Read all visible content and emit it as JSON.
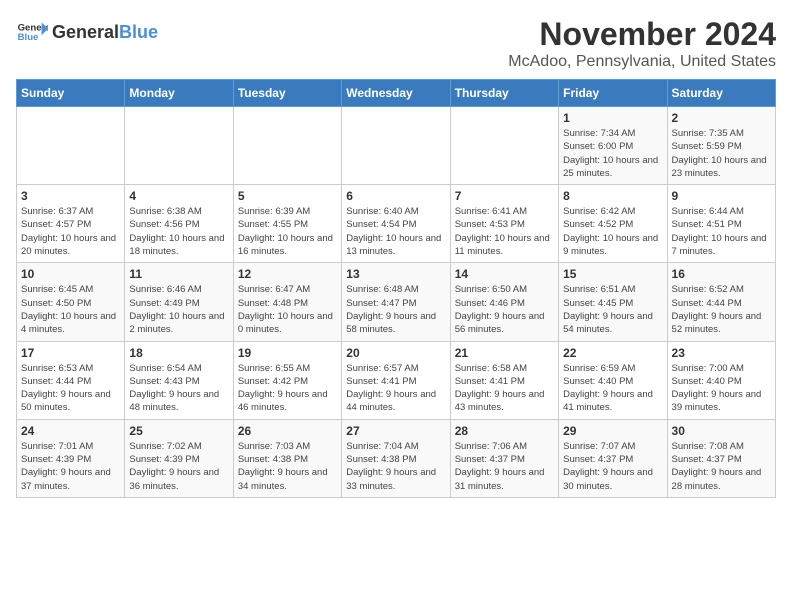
{
  "logo": {
    "general": "General",
    "blue": "Blue"
  },
  "title": "November 2024",
  "subtitle": "McAdoo, Pennsylvania, United States",
  "days_of_week": [
    "Sunday",
    "Monday",
    "Tuesday",
    "Wednesday",
    "Thursday",
    "Friday",
    "Saturday"
  ],
  "weeks": [
    [
      {
        "day": "",
        "info": ""
      },
      {
        "day": "",
        "info": ""
      },
      {
        "day": "",
        "info": ""
      },
      {
        "day": "",
        "info": ""
      },
      {
        "day": "",
        "info": ""
      },
      {
        "day": "1",
        "info": "Sunrise: 7:34 AM\nSunset: 6:00 PM\nDaylight: 10 hours and 25 minutes."
      },
      {
        "day": "2",
        "info": "Sunrise: 7:35 AM\nSunset: 5:59 PM\nDaylight: 10 hours and 23 minutes."
      }
    ],
    [
      {
        "day": "3",
        "info": "Sunrise: 6:37 AM\nSunset: 4:57 PM\nDaylight: 10 hours and 20 minutes."
      },
      {
        "day": "4",
        "info": "Sunrise: 6:38 AM\nSunset: 4:56 PM\nDaylight: 10 hours and 18 minutes."
      },
      {
        "day": "5",
        "info": "Sunrise: 6:39 AM\nSunset: 4:55 PM\nDaylight: 10 hours and 16 minutes."
      },
      {
        "day": "6",
        "info": "Sunrise: 6:40 AM\nSunset: 4:54 PM\nDaylight: 10 hours and 13 minutes."
      },
      {
        "day": "7",
        "info": "Sunrise: 6:41 AM\nSunset: 4:53 PM\nDaylight: 10 hours and 11 minutes."
      },
      {
        "day": "8",
        "info": "Sunrise: 6:42 AM\nSunset: 4:52 PM\nDaylight: 10 hours and 9 minutes."
      },
      {
        "day": "9",
        "info": "Sunrise: 6:44 AM\nSunset: 4:51 PM\nDaylight: 10 hours and 7 minutes."
      }
    ],
    [
      {
        "day": "10",
        "info": "Sunrise: 6:45 AM\nSunset: 4:50 PM\nDaylight: 10 hours and 4 minutes."
      },
      {
        "day": "11",
        "info": "Sunrise: 6:46 AM\nSunset: 4:49 PM\nDaylight: 10 hours and 2 minutes."
      },
      {
        "day": "12",
        "info": "Sunrise: 6:47 AM\nSunset: 4:48 PM\nDaylight: 10 hours and 0 minutes."
      },
      {
        "day": "13",
        "info": "Sunrise: 6:48 AM\nSunset: 4:47 PM\nDaylight: 9 hours and 58 minutes."
      },
      {
        "day": "14",
        "info": "Sunrise: 6:50 AM\nSunset: 4:46 PM\nDaylight: 9 hours and 56 minutes."
      },
      {
        "day": "15",
        "info": "Sunrise: 6:51 AM\nSunset: 4:45 PM\nDaylight: 9 hours and 54 minutes."
      },
      {
        "day": "16",
        "info": "Sunrise: 6:52 AM\nSunset: 4:44 PM\nDaylight: 9 hours and 52 minutes."
      }
    ],
    [
      {
        "day": "17",
        "info": "Sunrise: 6:53 AM\nSunset: 4:44 PM\nDaylight: 9 hours and 50 minutes."
      },
      {
        "day": "18",
        "info": "Sunrise: 6:54 AM\nSunset: 4:43 PM\nDaylight: 9 hours and 48 minutes."
      },
      {
        "day": "19",
        "info": "Sunrise: 6:55 AM\nSunset: 4:42 PM\nDaylight: 9 hours and 46 minutes."
      },
      {
        "day": "20",
        "info": "Sunrise: 6:57 AM\nSunset: 4:41 PM\nDaylight: 9 hours and 44 minutes."
      },
      {
        "day": "21",
        "info": "Sunrise: 6:58 AM\nSunset: 4:41 PM\nDaylight: 9 hours and 43 minutes."
      },
      {
        "day": "22",
        "info": "Sunrise: 6:59 AM\nSunset: 4:40 PM\nDaylight: 9 hours and 41 minutes."
      },
      {
        "day": "23",
        "info": "Sunrise: 7:00 AM\nSunset: 4:40 PM\nDaylight: 9 hours and 39 minutes."
      }
    ],
    [
      {
        "day": "24",
        "info": "Sunrise: 7:01 AM\nSunset: 4:39 PM\nDaylight: 9 hours and 37 minutes."
      },
      {
        "day": "25",
        "info": "Sunrise: 7:02 AM\nSunset: 4:39 PM\nDaylight: 9 hours and 36 minutes."
      },
      {
        "day": "26",
        "info": "Sunrise: 7:03 AM\nSunset: 4:38 PM\nDaylight: 9 hours and 34 minutes."
      },
      {
        "day": "27",
        "info": "Sunrise: 7:04 AM\nSunset: 4:38 PM\nDaylight: 9 hours and 33 minutes."
      },
      {
        "day": "28",
        "info": "Sunrise: 7:06 AM\nSunset: 4:37 PM\nDaylight: 9 hours and 31 minutes."
      },
      {
        "day": "29",
        "info": "Sunrise: 7:07 AM\nSunset: 4:37 PM\nDaylight: 9 hours and 30 minutes."
      },
      {
        "day": "30",
        "info": "Sunrise: 7:08 AM\nSunset: 4:37 PM\nDaylight: 9 hours and 28 minutes."
      }
    ]
  ]
}
